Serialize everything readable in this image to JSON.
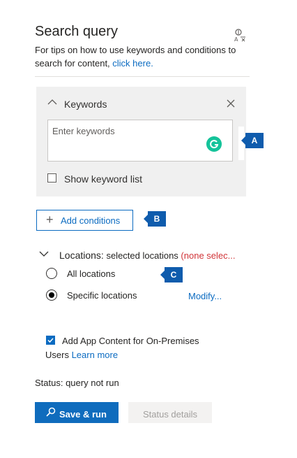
{
  "header": {
    "title": "Search query",
    "tips_text": "For tips on how to use keywords and conditions to search for content, ",
    "tips_link": "click here."
  },
  "keywords": {
    "label": "Keywords",
    "placeholder": "Enter keywords",
    "show_list_label": "Show keyword list",
    "callout": "A"
  },
  "conditions": {
    "add_label": "Add conditions",
    "callout": "B"
  },
  "locations": {
    "heading": "Locations:",
    "selected": "selected locations",
    "none": "(none selec...",
    "all_label": "All locations",
    "specific_label": "Specific locations",
    "modify_link": "Modify...",
    "callout": "C"
  },
  "app_content": {
    "label_line1": "Add App Content for On-Premises",
    "label_line2": "Users",
    "learn_more": "Learn more"
  },
  "status": {
    "text": "Status: query not run"
  },
  "actions": {
    "save_run": "Save & run",
    "status_details": "Status details"
  },
  "colors": {
    "accent": "#0f6cbd",
    "link": "#0b6bc1",
    "callout": "#0f5cad",
    "warning_red": "#d13438",
    "grammarly": "#15c39a"
  }
}
